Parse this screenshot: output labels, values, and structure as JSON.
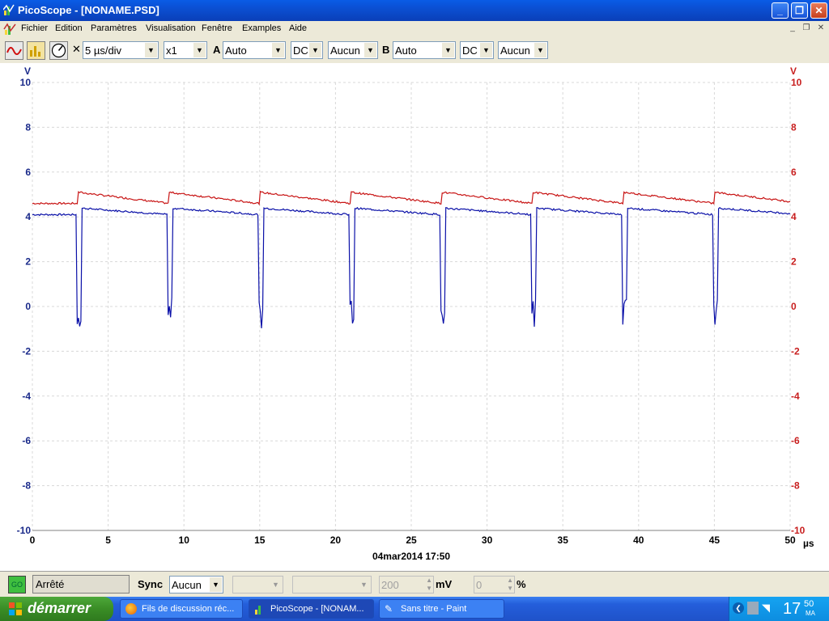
{
  "window": {
    "title": "PicoScope - [NONAME.PSD]"
  },
  "menu": [
    "Fichier",
    "Edition",
    "Paramètres",
    "Visualisation",
    "Fenêtre",
    "Examples",
    "Aide"
  ],
  "toolbar": {
    "close_x": "✕",
    "timebase": "5 µs/div",
    "multiplier": "x1",
    "channel_a_label": "A",
    "channel_a_range": "Auto",
    "channel_a_coupling": "DC",
    "channel_a_option": "Aucun",
    "channel_b_label": "B",
    "channel_b_range": "Auto",
    "channel_b_coupling": "DC",
    "channel_b_option": "Aucun"
  },
  "colors": {
    "channel_a": "#0a10a8",
    "channel_b": "#c81414",
    "grid": "#d8d8d8"
  },
  "chart_data": {
    "type": "line",
    "left_unit": "V",
    "right_unit": "V",
    "x_unit": "µs",
    "xlim": [
      0,
      50
    ],
    "ylim": [
      -10,
      10
    ],
    "x_ticks": [
      0,
      5,
      10,
      15,
      20,
      25,
      30,
      35,
      40,
      45,
      50
    ],
    "y_ticks": [
      10,
      8,
      6,
      4,
      2,
      0,
      -2,
      -4,
      -6,
      -8,
      -10
    ],
    "grid": true,
    "series": [
      {
        "color": "#0a10a8",
        "baseline": 4.1,
        "peak_after_pulse": 4.4,
        "pulse_min": -1.0,
        "pulse_times": [
          3,
          9,
          15,
          21,
          27,
          33,
          39,
          45
        ]
      },
      {
        "color": "#c81414",
        "baseline": 4.6,
        "peak_after_pulse": 5.1,
        "pulse_times": [
          3,
          9,
          15,
          21,
          27,
          33,
          39,
          45
        ]
      }
    ],
    "timestamp": "04mar2014  17:50"
  },
  "status": {
    "go_label": "GO",
    "state": "Arrêté",
    "sync_label": "Sync",
    "sync_value": "Aucun",
    "level_value": "200",
    "level_unit": "mV",
    "pct_value": "0",
    "pct_unit": "%"
  },
  "taskbar": {
    "start": "démarrer",
    "tasks": [
      "Fils de discussion réc...",
      "PicoScope - [NONAM...",
      "Sans titre - Paint"
    ],
    "clock": "17",
    "clock_min": "50",
    "clock_suffix": "MA"
  }
}
